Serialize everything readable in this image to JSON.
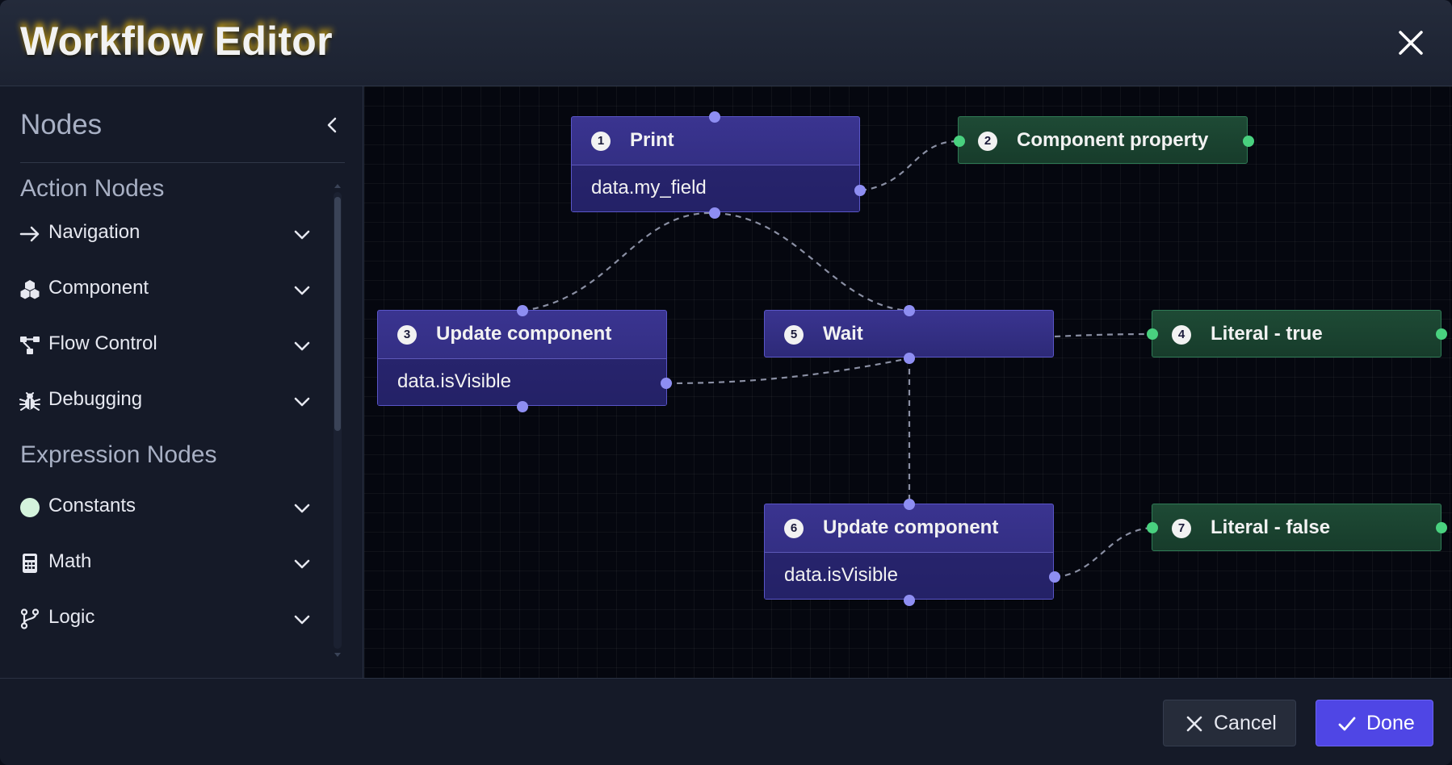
{
  "header": {
    "title": "Workflow Editor"
  },
  "sidebar": {
    "title": "Nodes",
    "sections": [
      {
        "title": "Action Nodes",
        "items": [
          {
            "label": "Navigation",
            "icon": "arrow-right-icon"
          },
          {
            "label": "Component",
            "icon": "cubes-icon"
          },
          {
            "label": "Flow Control",
            "icon": "flow-icon"
          },
          {
            "label": "Debugging",
            "icon": "bug-icon"
          }
        ]
      },
      {
        "title": "Expression Nodes",
        "items": [
          {
            "label": "Constants",
            "icon": "circle-icon"
          },
          {
            "label": "Math",
            "icon": "calculator-icon"
          },
          {
            "label": "Logic",
            "icon": "branch-icon"
          }
        ]
      }
    ]
  },
  "nodes": [
    {
      "id": "1",
      "title": "Print",
      "field": "data.my_field",
      "kind": "action"
    },
    {
      "id": "2",
      "title": "Component property",
      "kind": "expression"
    },
    {
      "id": "3",
      "title": "Update component",
      "field": "data.isVisible",
      "kind": "action"
    },
    {
      "id": "5",
      "title": "Wait",
      "kind": "action"
    },
    {
      "id": "4",
      "title": "Literal - true",
      "kind": "expression"
    },
    {
      "id": "6",
      "title": "Update component",
      "field": "data.isVisible",
      "kind": "action"
    },
    {
      "id": "7",
      "title": "Literal - false",
      "kind": "expression"
    }
  ],
  "footer": {
    "cancel_label": "Cancel",
    "done_label": "Done"
  },
  "colors": {
    "action_node": "#2d2a78",
    "expression_node": "#173c2b",
    "port_action": "#8e8ef2",
    "port_expression": "#49d17f",
    "primary_button": "#4f46e5"
  }
}
